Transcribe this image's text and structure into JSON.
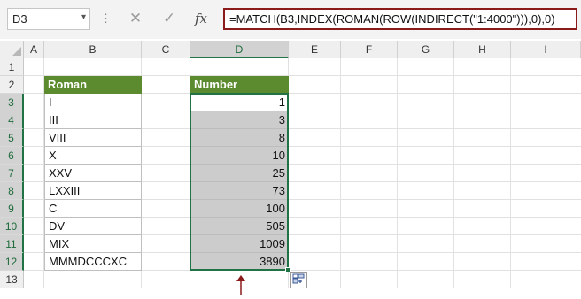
{
  "formula_bar": {
    "name_box": "D3",
    "name_box_arrow": "▾",
    "dots": "⋮",
    "cancel_glyph": "✕",
    "enter_glyph": "✓",
    "fx_glyph": "fx",
    "formula": "=MATCH(B3,INDEX(ROMAN(ROW(INDIRECT(\"1:4000\"))),0),0)"
  },
  "columns": [
    "A",
    "B",
    "C",
    "D",
    "E",
    "F",
    "G",
    "H",
    "I"
  ],
  "rows": [
    "1",
    "2",
    "3",
    "4",
    "5",
    "6",
    "7",
    "8",
    "9",
    "10",
    "11",
    "12",
    "13"
  ],
  "selected_column": "D",
  "table": {
    "roman_header": "Roman",
    "number_header": "Number",
    "roman": [
      "I",
      "III",
      "VIII",
      "X",
      "XXV",
      "LXXIII",
      "C",
      "DV",
      "MIX",
      "MMMDCCCXC"
    ],
    "numbers": [
      "1",
      "3",
      "8",
      "10",
      "25",
      "73",
      "100",
      "505",
      "1009",
      "3890"
    ]
  },
  "quick_analysis_icon": "quick-analysis-icon",
  "colors": {
    "header_green": "#5c8a2e",
    "selection_green": "#217346",
    "arrow_red": "#8b1a1a"
  }
}
